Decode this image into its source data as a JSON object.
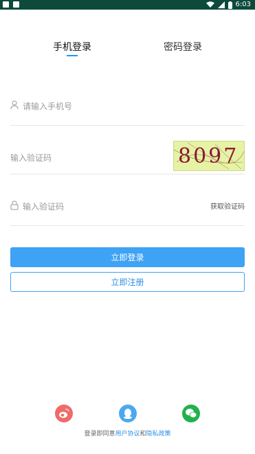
{
  "status_bar": {
    "time": "6:03"
  },
  "tabs": [
    {
      "label": "手机登录",
      "active": true
    },
    {
      "label": "密码登录",
      "active": false
    }
  ],
  "form": {
    "phone_placeholder": "请输入手机号",
    "captcha_placeholder": "输入验证码",
    "captcha_code": "8097",
    "sms_placeholder": "输入验证码",
    "get_code_label": "获取验证码"
  },
  "buttons": {
    "login": "立即登录",
    "register": "立即注册"
  },
  "social_icons": [
    "weibo-icon",
    "qq-icon",
    "wechat-icon"
  ],
  "agreement": {
    "prefix": "登录即同意",
    "user_agreement": "用户协议",
    "and": "和",
    "privacy_policy": "隐私政策"
  },
  "colors": {
    "status_bar": "#0d4a3c",
    "accent": "#3ea2f5",
    "weibo": "#f06a6a",
    "qq": "#4aa9f0",
    "wechat": "#22b14c"
  }
}
